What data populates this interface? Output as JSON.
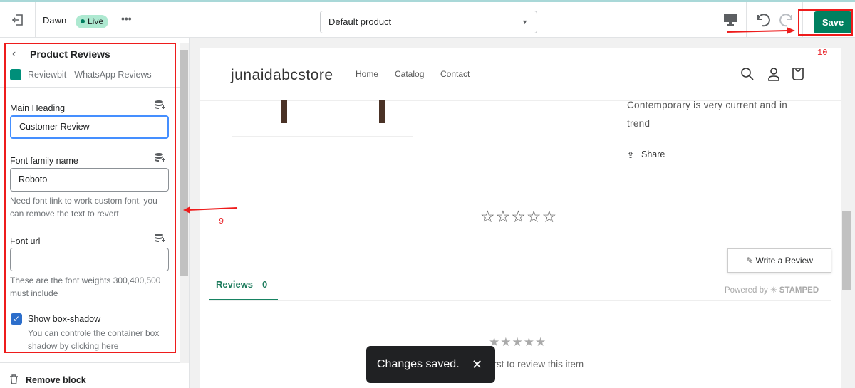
{
  "topbar": {
    "theme_name": "Dawn",
    "status_badge": "Live",
    "more_label": "•••",
    "template_select": "Default product",
    "save_label": "Save"
  },
  "sidebar": {
    "title": "Product Reviews",
    "app_name": "Reviewbit - WhatsApp Reviews",
    "fields": [
      {
        "label": "Main Heading",
        "value": "Customer Review"
      },
      {
        "label": "Font family name",
        "value": "Roboto",
        "help": "Need font link to work custom font. you can remove the text to revert"
      },
      {
        "label": "Font url",
        "value": "",
        "help": "These are the font weights 300,400,500 must include"
      }
    ],
    "checkbox": {
      "label": "Show box-shadow",
      "checked": true,
      "help": "You can controle the container box shadow by clicking here"
    },
    "remove_block": "Remove block"
  },
  "preview": {
    "store_name": "junaidabcstore",
    "nav": [
      "Home",
      "Catalog",
      "Contact"
    ],
    "description": "Contemporary is very current and in trend",
    "share_label": "Share",
    "write_review": "Write a Review",
    "tab_label": "Reviews",
    "tab_count": "0",
    "powered_by": "Powered by",
    "stamped": "STAMPED",
    "empty_text": "Be the first to review this item",
    "rating_stars": 0
  },
  "annotations": {
    "sidebar_number": "9",
    "save_number": "10",
    "annotation_color": "#ee1c1c"
  },
  "toast": {
    "message": "Changes saved.",
    "close": "✕"
  },
  "colors": {
    "accent": "#008060",
    "badge": "#aee9d1"
  }
}
